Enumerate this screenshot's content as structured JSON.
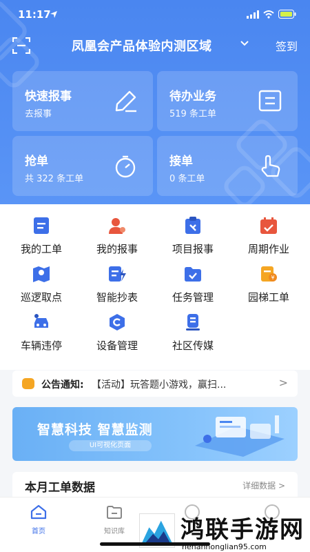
{
  "status": {
    "time": "11:17"
  },
  "header": {
    "title": "凤凰会产品体验内测区域",
    "signin": "签到"
  },
  "cards": [
    {
      "title": "快速报事",
      "sub": "去报事",
      "icon": "pencil-icon"
    },
    {
      "title": "待办业务",
      "sub": "519 条工单",
      "icon": "document-icon"
    },
    {
      "title": "抢单",
      "sub": "共 322 条工单",
      "icon": "stopwatch-icon"
    },
    {
      "title": "接单",
      "sub": "0 条工单",
      "icon": "hand-pointer-icon"
    }
  ],
  "grid": [
    {
      "label": "我的工单",
      "icon": "document-icon",
      "color": "#3d6fe8"
    },
    {
      "label": "我的报事",
      "icon": "user-icon",
      "color": "#e8563d"
    },
    {
      "label": "项目报事",
      "icon": "clipboard-icon",
      "color": "#3d6fe8"
    },
    {
      "label": "周期作业",
      "icon": "calendar-icon",
      "color": "#e8563d"
    },
    {
      "label": "巡逻取点",
      "icon": "map-pin-icon",
      "color": "#3d6fe8"
    },
    {
      "label": "智能抄表",
      "icon": "meter-icon",
      "color": "#3d6fe8"
    },
    {
      "label": "任务管理",
      "icon": "folder-check-icon",
      "color": "#3d6fe8"
    },
    {
      "label": "园梯工单",
      "icon": "coin-doc-icon",
      "color": "#f5a623"
    },
    {
      "label": "车辆违停",
      "icon": "car-icon",
      "color": "#3d6fe8"
    },
    {
      "label": "设备管理",
      "icon": "device-icon",
      "color": "#3d6fe8"
    },
    {
      "label": "社区传媒",
      "icon": "media-icon",
      "color": "#3d6fe8"
    }
  ],
  "notice": {
    "heading": "公告通知:",
    "text": "【活动】玩答题小游戏，赢扫...",
    "arrow": ">"
  },
  "banner": {
    "title": "智慧科技 智慧监测",
    "subtitle": "UI可视化页面"
  },
  "panel": {
    "title": "本月工单数据",
    "more": "详细数据 >"
  },
  "tabs": [
    {
      "label": "首页",
      "active": true
    },
    {
      "label": "知识库",
      "active": false
    }
  ],
  "watermark": {
    "text": "鸿联手游网",
    "url": "henanhonglian95.com"
  },
  "colors": {
    "primary": "#4a86f0",
    "accent": "#3d6fe8",
    "warn": "#e8563d"
  }
}
